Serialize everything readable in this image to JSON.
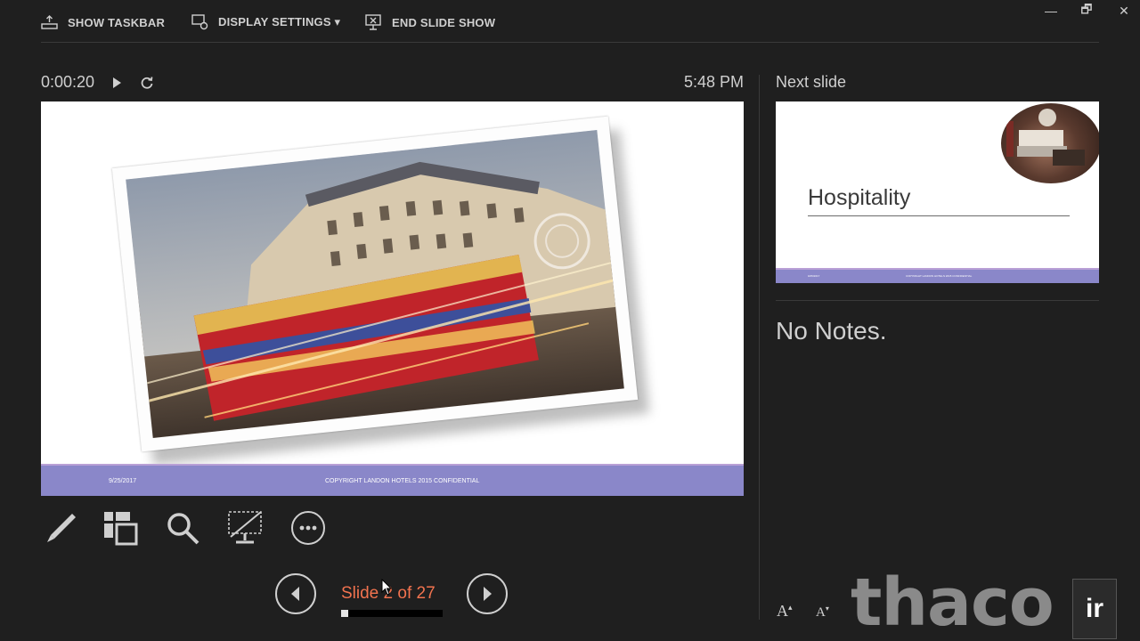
{
  "toolbar": {
    "show_taskbar": "SHOW TASKBAR",
    "display_settings": "DISPLAY SETTINGS ▾",
    "end_slide_show": "END SLIDE SHOW"
  },
  "window_controls": {
    "minimize": "—",
    "restore": "🗗",
    "close": "✕"
  },
  "presenter": {
    "timer": "0:00:20",
    "clock": "5:48 PM",
    "current_slide": {
      "footer_date": "9/25/2017",
      "footer_text": "COPYRIGHT LANDON HOTELS 2015 CONFIDENTIAL"
    },
    "tools": [
      "pen-tool",
      "see-all-slides",
      "zoom",
      "black-screen",
      "more-options"
    ],
    "slide_counter": "Slide 2 of 27",
    "progress_fraction": 0.074
  },
  "next": {
    "label": "Next slide",
    "title": "Hospitality",
    "footer_date": "9/25/2017",
    "footer_text": "COPYRIGHT LANDON HOTELS 2015 CONFIDENTIAL"
  },
  "notes": {
    "text": "No Notes."
  },
  "font_controls": {
    "increase": "A",
    "decrease": "A"
  },
  "watermark": {
    "text": "thaco",
    "box": "ir"
  },
  "colors": {
    "accent": "#f2734f",
    "footer": "#8a87c9",
    "background": "#1f1f1f"
  }
}
